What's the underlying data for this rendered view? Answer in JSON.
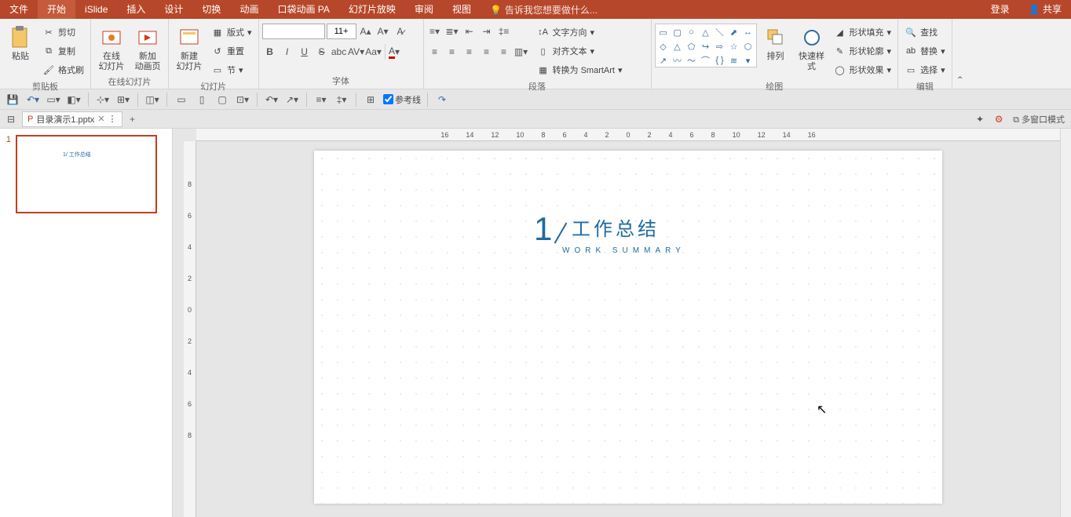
{
  "menu": {
    "items": [
      "文件",
      "开始",
      "iSlide",
      "插入",
      "设计",
      "切换",
      "动画",
      "口袋动画 PA",
      "幻灯片放映",
      "审阅",
      "视图"
    ],
    "active_index": 1,
    "tell_me": "告诉我您想要做什么...",
    "login": "登录",
    "share": "共享"
  },
  "ribbon": {
    "clipboard": {
      "label": "剪贴板",
      "paste": "粘贴",
      "cut": "剪切",
      "copy": "复制",
      "format_painter": "格式刷"
    },
    "online_slides": {
      "label": "在线幻灯片",
      "online": "在线\n幻灯片",
      "new_anim": "新加\n动画页"
    },
    "slides": {
      "label": "幻灯片",
      "new_slide": "新建\n幻灯片",
      "layout": "版式",
      "reset": "重置",
      "section": "节"
    },
    "font": {
      "label": "字体",
      "size": "11+",
      "bold": "B",
      "italic": "I",
      "underline": "U",
      "strike": "S"
    },
    "paragraph": {
      "label": "段落",
      "text_dir": "文字方向",
      "align_text": "对齐文本",
      "smartart": "转换为 SmartArt"
    },
    "drawing": {
      "label": "绘图",
      "arrange": "排列",
      "quick_style": "快速样式",
      "shape_fill": "形状填充",
      "shape_outline": "形状轮廓",
      "shape_effects": "形状效果"
    },
    "editing": {
      "label": "编辑",
      "find": "查找",
      "replace": "替换",
      "select": "选择"
    }
  },
  "qat": {
    "guides": "参考线"
  },
  "tab": {
    "filename": "目录演示1.pptx",
    "multi_window": "多窗口模式"
  },
  "thumbnails": {
    "slide1_num": "1"
  },
  "slide": {
    "number": "1",
    "title": "工作总结",
    "subtitle": "WORK SUMMARY"
  },
  "ruler_h": [
    "16",
    "14",
    "12",
    "10",
    "8",
    "6",
    "4",
    "2",
    "0",
    "2",
    "4",
    "6",
    "8",
    "10",
    "12",
    "14",
    "16"
  ],
  "ruler_v": [
    "8",
    "6",
    "4",
    "2",
    "0",
    "2",
    "4",
    "6",
    "8"
  ]
}
